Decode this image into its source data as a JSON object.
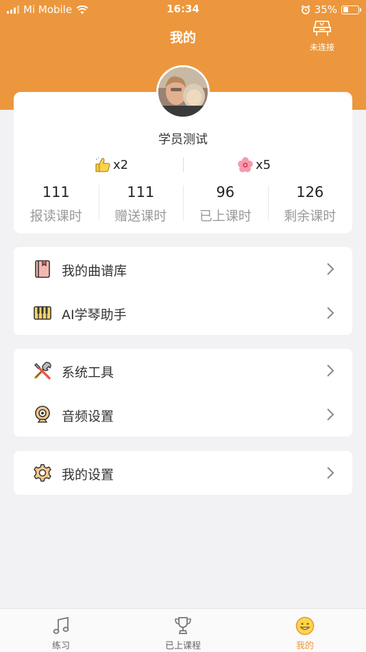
{
  "status_bar": {
    "carrier": "Mi Mobile",
    "time": "16:34",
    "battery": "35%",
    "battery_level": 0.35
  },
  "header": {
    "title": "我的",
    "connection_status": "未连接"
  },
  "profile": {
    "name": "学员测试",
    "likes": "x2",
    "flowers": "x5",
    "stats": [
      {
        "value": "111",
        "label": "报读课时"
      },
      {
        "value": "111",
        "label": "赠送课时"
      },
      {
        "value": "96",
        "label": "已上课时"
      },
      {
        "value": "126",
        "label": "剩余课时"
      }
    ]
  },
  "menu": {
    "group1": [
      {
        "label": "我的曲谱库",
        "icon": "book-icon"
      },
      {
        "label": "AI学琴助手",
        "icon": "piano-keys-icon"
      }
    ],
    "group2": [
      {
        "label": "系统工具",
        "icon": "tools-icon"
      },
      {
        "label": "音频设置",
        "icon": "webcam-icon"
      }
    ],
    "group3": [
      {
        "label": "我的设置",
        "icon": "gear-icon"
      }
    ]
  },
  "tabs": [
    {
      "label": "练习",
      "icon": "music-note-icon",
      "active": false
    },
    {
      "label": "已上课程",
      "icon": "trophy-icon",
      "active": false
    },
    {
      "label": "我的",
      "icon": "smiley-icon",
      "active": true
    }
  ],
  "colors": {
    "accent": "#ec973d",
    "background": "#f2f2f5"
  }
}
